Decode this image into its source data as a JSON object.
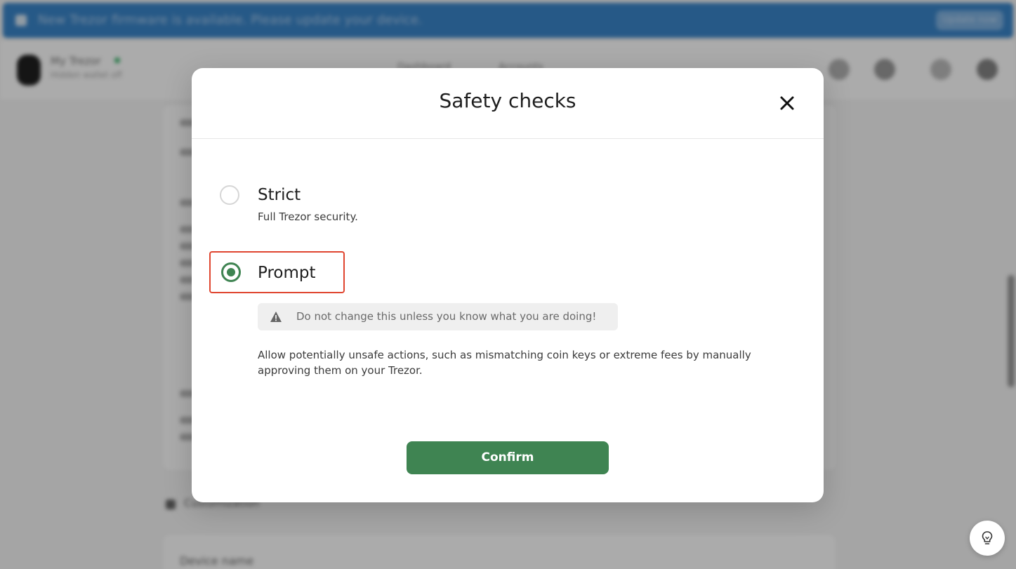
{
  "banner": {
    "text": "New Trezor firmware is available. Please update your device.",
    "button_label": "Update now"
  },
  "topbar": {
    "device_name": "My Trezor",
    "device_status": "Hidden wallet off",
    "tabs": [
      "Dashboard",
      "Accounts"
    ]
  },
  "background": {
    "section_label": "Customization",
    "card_label": "Device name"
  },
  "modal": {
    "title": "Safety checks",
    "options": [
      {
        "title": "Strict",
        "description": "Full Trezor security.",
        "selected": false
      },
      {
        "title": "Prompt",
        "selected": true,
        "warning": "Do not change this unless you know what you are doing!",
        "description": "Allow potentially unsafe actions, such as mismatching coin keys or extreme fees by manually approving them on your Trezor."
      }
    ],
    "confirm_label": "Confirm"
  },
  "colors": {
    "accent": "#3f8452",
    "highlight": "#e0452f",
    "banner": "#3a85c9",
    "overlay": "rgba(0,0,0,0.33)"
  },
  "icons": {
    "close": "close-icon",
    "warning": "warning-icon",
    "tip": "lightbulb-icon"
  }
}
